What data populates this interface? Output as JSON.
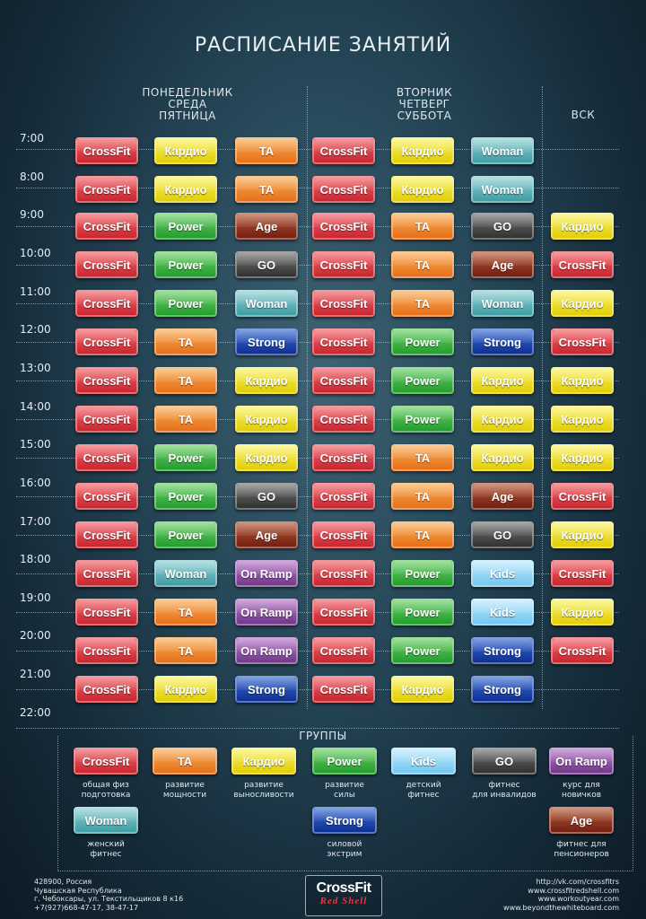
{
  "title": "РАСПИСАНИЕ ЗАНЯТИЙ",
  "day_groups": [
    {
      "lines": [
        "ПОНЕДЕЛЬНИК",
        "СРЕДА",
        "ПЯТНИЦА"
      ]
    },
    {
      "lines": [
        "ВТОРНИК",
        "ЧЕТВЕРГ",
        "СУББОТА"
      ]
    },
    {
      "lines": [
        "ВСК"
      ]
    }
  ],
  "times": [
    "7:00",
    "8:00",
    "9:00",
    "10:00",
    "11:00",
    "12:00",
    "13:00",
    "14:00",
    "15:00",
    "16:00",
    "17:00",
    "18:00",
    "19:00",
    "20:00",
    "21:00",
    "22:00"
  ],
  "class_types": {
    "crossfit": "CrossFit",
    "cardio": "Кардио",
    "ta": "TA",
    "power": "Power",
    "age": "Age",
    "woman": "Woman",
    "strong": "Strong",
    "go": "GO",
    "onramp": "On Ramp",
    "kids": "Kids"
  },
  "schedule": [
    [
      "crossfit",
      "cardio",
      "ta",
      "crossfit",
      "cardio",
      "woman",
      ""
    ],
    [
      "crossfit",
      "cardio",
      "ta",
      "crossfit",
      "cardio",
      "woman",
      ""
    ],
    [
      "crossfit",
      "power",
      "age",
      "crossfit",
      "ta",
      "go",
      "cardio"
    ],
    [
      "crossfit",
      "power",
      "go",
      "crossfit",
      "ta",
      "age",
      "crossfit"
    ],
    [
      "crossfit",
      "power",
      "woman",
      "crossfit",
      "ta",
      "woman",
      "cardio"
    ],
    [
      "crossfit",
      "ta",
      "strong",
      "crossfit",
      "power",
      "strong",
      "crossfit"
    ],
    [
      "crossfit",
      "ta",
      "cardio",
      "crossfit",
      "power",
      "cardio",
      "cardio"
    ],
    [
      "crossfit",
      "ta",
      "cardio",
      "crossfit",
      "power",
      "cardio",
      "cardio"
    ],
    [
      "crossfit",
      "power",
      "cardio",
      "crossfit",
      "ta",
      "cardio",
      "cardio"
    ],
    [
      "crossfit",
      "power",
      "go",
      "crossfit",
      "ta",
      "age",
      "crossfit"
    ],
    [
      "crossfit",
      "power",
      "age",
      "crossfit",
      "ta",
      "go",
      "cardio"
    ],
    [
      "crossfit",
      "woman",
      "onramp",
      "crossfit",
      "power",
      "kids",
      "crossfit"
    ],
    [
      "crossfit",
      "ta",
      "onramp",
      "crossfit",
      "power",
      "kids",
      "cardio"
    ],
    [
      "crossfit",
      "ta",
      "onramp",
      "crossfit",
      "power",
      "strong",
      "crossfit"
    ],
    [
      "crossfit",
      "cardio",
      "strong",
      "crossfit",
      "cardio",
      "strong",
      ""
    ]
  ],
  "legend": {
    "title": "ГРУППЫ",
    "items": [
      {
        "type": "crossfit",
        "caption": [
          "общая физ",
          "подготовка"
        ]
      },
      {
        "type": "ta",
        "caption": [
          "развитие",
          "мощности"
        ]
      },
      {
        "type": "cardio",
        "caption": [
          "развитие",
          "выносливости"
        ]
      },
      {
        "type": "power",
        "caption": [
          "развитие",
          "силы"
        ]
      },
      {
        "type": "kids",
        "caption": [
          "детский",
          "фитнес"
        ]
      },
      {
        "type": "go",
        "caption": [
          "фитнес",
          "для инвалидов"
        ]
      },
      {
        "type": "onramp",
        "caption": [
          "курс для",
          "новичков"
        ]
      },
      {
        "type": "woman",
        "caption": [
          "женский",
          "фитнес"
        ]
      },
      {
        "type": "strong",
        "caption": [
          "силовой",
          "экстрим"
        ]
      },
      {
        "type": "age",
        "caption": [
          "фитнес для",
          "пенсионеров"
        ]
      }
    ]
  },
  "footer": {
    "address": [
      "428900, Россия",
      "Чувашская Республика",
      "г. Чебоксары, ул. Текстильщиков 8 к16",
      "+7(927)668-47-17, 38-47-17"
    ],
    "logo_main": "CrossFit",
    "logo_sub": "Red Shell",
    "links": [
      "http://vk.com/crossfitrs",
      "www.crossfitredshell.com",
      "www.workoutyear.com",
      "www.beyondthewhiteboard.com"
    ]
  },
  "colors": {
    "crossfit": "#d9343b",
    "cardio": "#f0e21a",
    "ta": "#ef8a2d",
    "power": "#2fae34",
    "age": "#8b2a18",
    "woman": "#5fb4b8",
    "strong": "#1a3fae",
    "go": "#3a3a3a",
    "onramp": "#8a4aa0",
    "kids": "#8fd6f6"
  }
}
